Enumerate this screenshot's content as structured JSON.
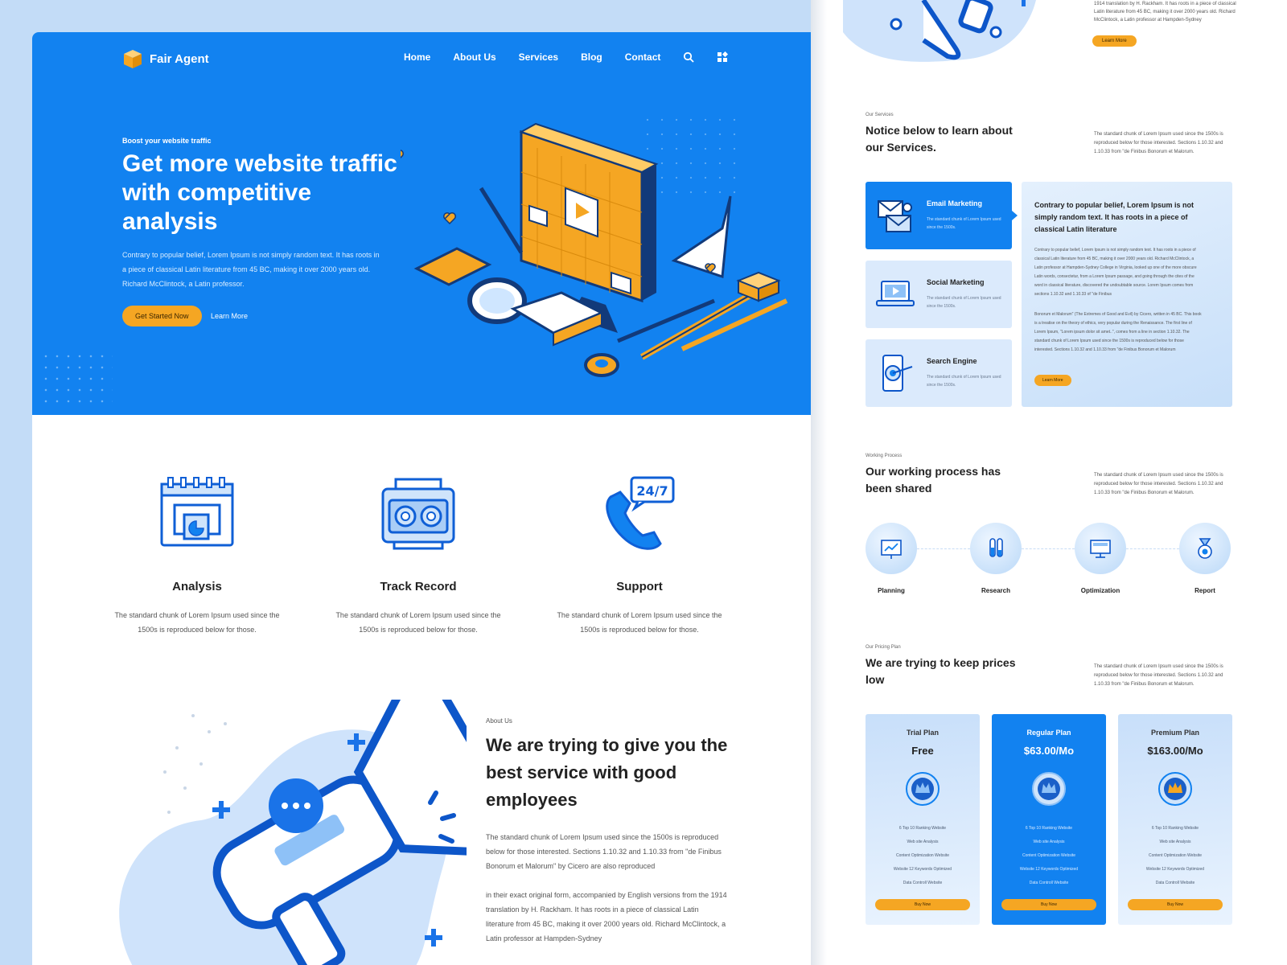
{
  "brand": {
    "name": "Fair Agent",
    "primary": "#1282f0",
    "accent": "#f5a623"
  },
  "nav": {
    "items": [
      "Home",
      "About Us",
      "Services",
      "Blog",
      "Contact"
    ],
    "icons": [
      "search-icon",
      "grid-menu-icon"
    ]
  },
  "hero": {
    "eyebrow": "Boost your website traffic",
    "title": "Get more website traffic with competitive analysis",
    "description": "Contrary to popular belief, Lorem Ipsum is not simply random text. It has roots in a piece of classical Latin literature from 45 BC, making it over 2000 years old. Richard McClintock, a Latin professor.",
    "cta": "Get Started Now",
    "secondary": "Learn More"
  },
  "features": [
    {
      "icon": "calendar-chart-icon",
      "title": "Analysis",
      "text": "The standard chunk of Lorem Ipsum used since the 1500s is reproduced below for those."
    },
    {
      "icon": "radio-icon",
      "title": "Track Record",
      "text": "The standard chunk of Lorem Ipsum used since the 1500s is reproduced below for those."
    },
    {
      "icon": "phone-24-7-icon",
      "title": "Support",
      "text": "The standard chunk of Lorem Ipsum used since the 1500s is reproduced below for those."
    }
  ],
  "about": {
    "eyebrow": "About Us",
    "title": "We are trying to give you the best service with good employees",
    "p1": "The standard chunk of Lorem Ipsum used since the 1500s is reproduced below for those interested. Sections 1.10.32 and 1.10.33 from \"de Finibus Bonorum et Malorum\" by Cicero are also reproduced",
    "p2": "in their exact original form, accompanied by English versions from the 1914 translation by H. Rackham. It has roots in a piece of classical Latin literature from 45 BC, making it over 2000 years old. Richard McClintock, a Latin professor at Hampden-Sydney"
  },
  "right_top": {
    "text": "1914 translation by H. Rackham. It has roots in a piece of classical Latin literature from 45 BC, making it over 2000 years old. Richard McClintock, a Latin professor at Hampden-Sydney",
    "button": "Learn More"
  },
  "services": {
    "eyebrow": "Our Services",
    "title": "Notice below to learn about our Services.",
    "desc": "The standard chunk of Lorem Ipsum used since the 1500s is reproduced below for those interested. Sections 1.10.32 and 1.10.33 from \"de Finibus Bonorum et Malorum.",
    "items": [
      {
        "icon": "email-icon",
        "name": "Email Marketing",
        "desc": "The standard chunk of Lorem Ipsum used since the 1500s."
      },
      {
        "icon": "laptop-video-icon",
        "name": "Social Marketing",
        "desc": "The standard chunk of Lorem Ipsum used since the 1500s."
      },
      {
        "icon": "phone-target-icon",
        "name": "Search Engine",
        "desc": "The standard chunk of Lorem Ipsum used since the 1500s."
      }
    ],
    "detail": {
      "title": "Contrary to popular belief, Lorem Ipsum is not simply random text. It has roots in a piece of classical Latin literature",
      "p1": "Contrary to popular belief, Lorem Ipsum is not simply random text. It has roots in a piece of classical Latin literature from 45 BC, making it over 2000 years old. Richard McClintock, a Latin professor at Hampden-Sydney College in Virginia, looked up one of the more obscure Latin words, consectetur, from a Lorem Ipsum passage, and going through the cites of the word in classical literature, discovered the undoubtable source. Lorem Ipsum comes from sections 1.10.32 and 1.10.33 of \"de Finibus",
      "p2": "Bonorum et Malorum\" (The Extremes of Good and Evil) by Cicero, written in 45 BC. This book is a treatise on the theory of ethics, very popular during the Renaissance. The first line of Lorem Ipsum, \"Lorem ipsum dolor sit amet..\", comes from a line in section 1.10.32. The standard chunk of Lorem Ipsum used since the 1500s is reproduced below for those interested. Sections 1.10.32 and 1.10.33 from \"de Finibus Bonorum et Malorum",
      "button": "Learn More"
    }
  },
  "process": {
    "eyebrow": "Working Process",
    "title": "Our working process has been shared",
    "desc": "The standard chunk of Lorem Ipsum used since the 1500s is reproduced below for those interested. Sections 1.10.32 and 1.10.33 from \"de Finibus Bonorum et Malorum.",
    "steps": [
      {
        "icon": "chart-board-icon",
        "label": "Planning"
      },
      {
        "icon": "test-tubes-icon",
        "label": "Research"
      },
      {
        "icon": "monitor-gear-icon",
        "label": "Optimization"
      },
      {
        "icon": "medal-icon",
        "label": "Report"
      }
    ]
  },
  "pricing": {
    "eyebrow": "Our Pricing Plan",
    "title": "We are trying to keep prices low",
    "desc": "The standard chunk of Lorem Ipsum used since the 1500s is reproduced below for those interested. Sections 1.10.32 and 1.10.33 from \"de Finibus Bonorum et Malorum.",
    "plans": [
      {
        "name": "Trial Plan",
        "price": "Free",
        "featured": false,
        "features": [
          "6 Top 10 Ranking Website",
          "Web site Analysis",
          "Content Optimization Website",
          "Website 12 Keywords Optimized",
          "Data Controll Website"
        ],
        "button": "Buy Now"
      },
      {
        "name": "Regular Plan",
        "price": "$63.00/Mo",
        "featured": true,
        "features": [
          "6 Top 10 Ranking Website",
          "Web site Analysis",
          "Content Optimization Website",
          "Website 12 Keywords Optimized",
          "Data Controll Website"
        ],
        "button": "Buy Now"
      },
      {
        "name": "Premium Plan",
        "price": "$163.00/Mo",
        "featured": false,
        "features": [
          "6 Top 10 Ranking Website",
          "Web site Analysis",
          "Content Optimization Website",
          "Website 12 Keywords Optimized",
          "Data Controll Website"
        ],
        "button": "Buy Now"
      }
    ]
  }
}
